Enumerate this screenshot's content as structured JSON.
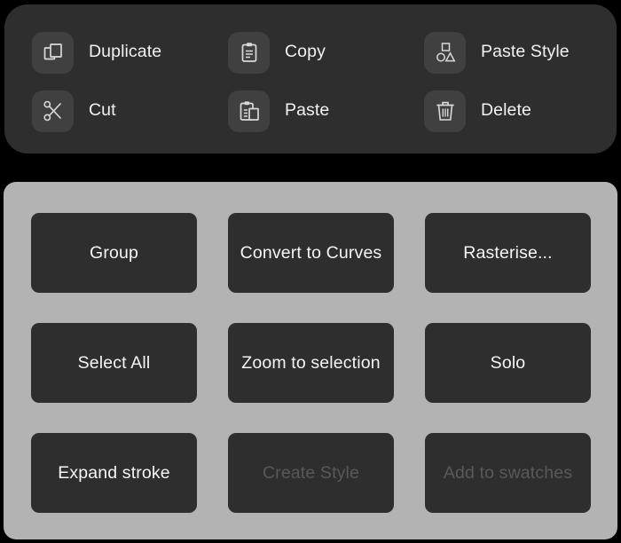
{
  "theme": {
    "page_background": "#000000",
    "menu_panel_background": "#2e2e2e",
    "menu_icon_tile_background": "#404040",
    "menu_label_color": "#f2f2f2",
    "action_panel_background": "#b3b3b3",
    "action_button_background": "#2e2e2e",
    "action_button_text_color": "#f5f5f5",
    "action_button_disabled_text_color": "#595959"
  },
  "context_menu": {
    "items": [
      {
        "label": "Duplicate",
        "icon": "duplicate-icon",
        "column": 1,
        "row": 1
      },
      {
        "label": "Copy",
        "icon": "clipboard-copy-icon",
        "column": 2,
        "row": 1
      },
      {
        "label": "Paste Style",
        "icon": "shapes-style-icon",
        "column": 3,
        "row": 1
      },
      {
        "label": "Cut",
        "icon": "scissors-icon",
        "column": 1,
        "row": 2
      },
      {
        "label": "Paste",
        "icon": "clipboard-paste-icon",
        "column": 2,
        "row": 2
      },
      {
        "label": "Delete",
        "icon": "trash-icon",
        "column": 3,
        "row": 2
      }
    ]
  },
  "action_panel": {
    "buttons": [
      {
        "label": "Group",
        "enabled": true
      },
      {
        "label": "Convert to Curves",
        "enabled": true
      },
      {
        "label": "Rasterise...",
        "enabled": true
      },
      {
        "label": "Select All",
        "enabled": true
      },
      {
        "label": "Zoom to selection",
        "enabled": true
      },
      {
        "label": "Solo",
        "enabled": true
      },
      {
        "label": "Expand stroke",
        "enabled": true
      },
      {
        "label": "Create Style",
        "enabled": false
      },
      {
        "label": "Add to swatches",
        "enabled": false
      }
    ]
  }
}
